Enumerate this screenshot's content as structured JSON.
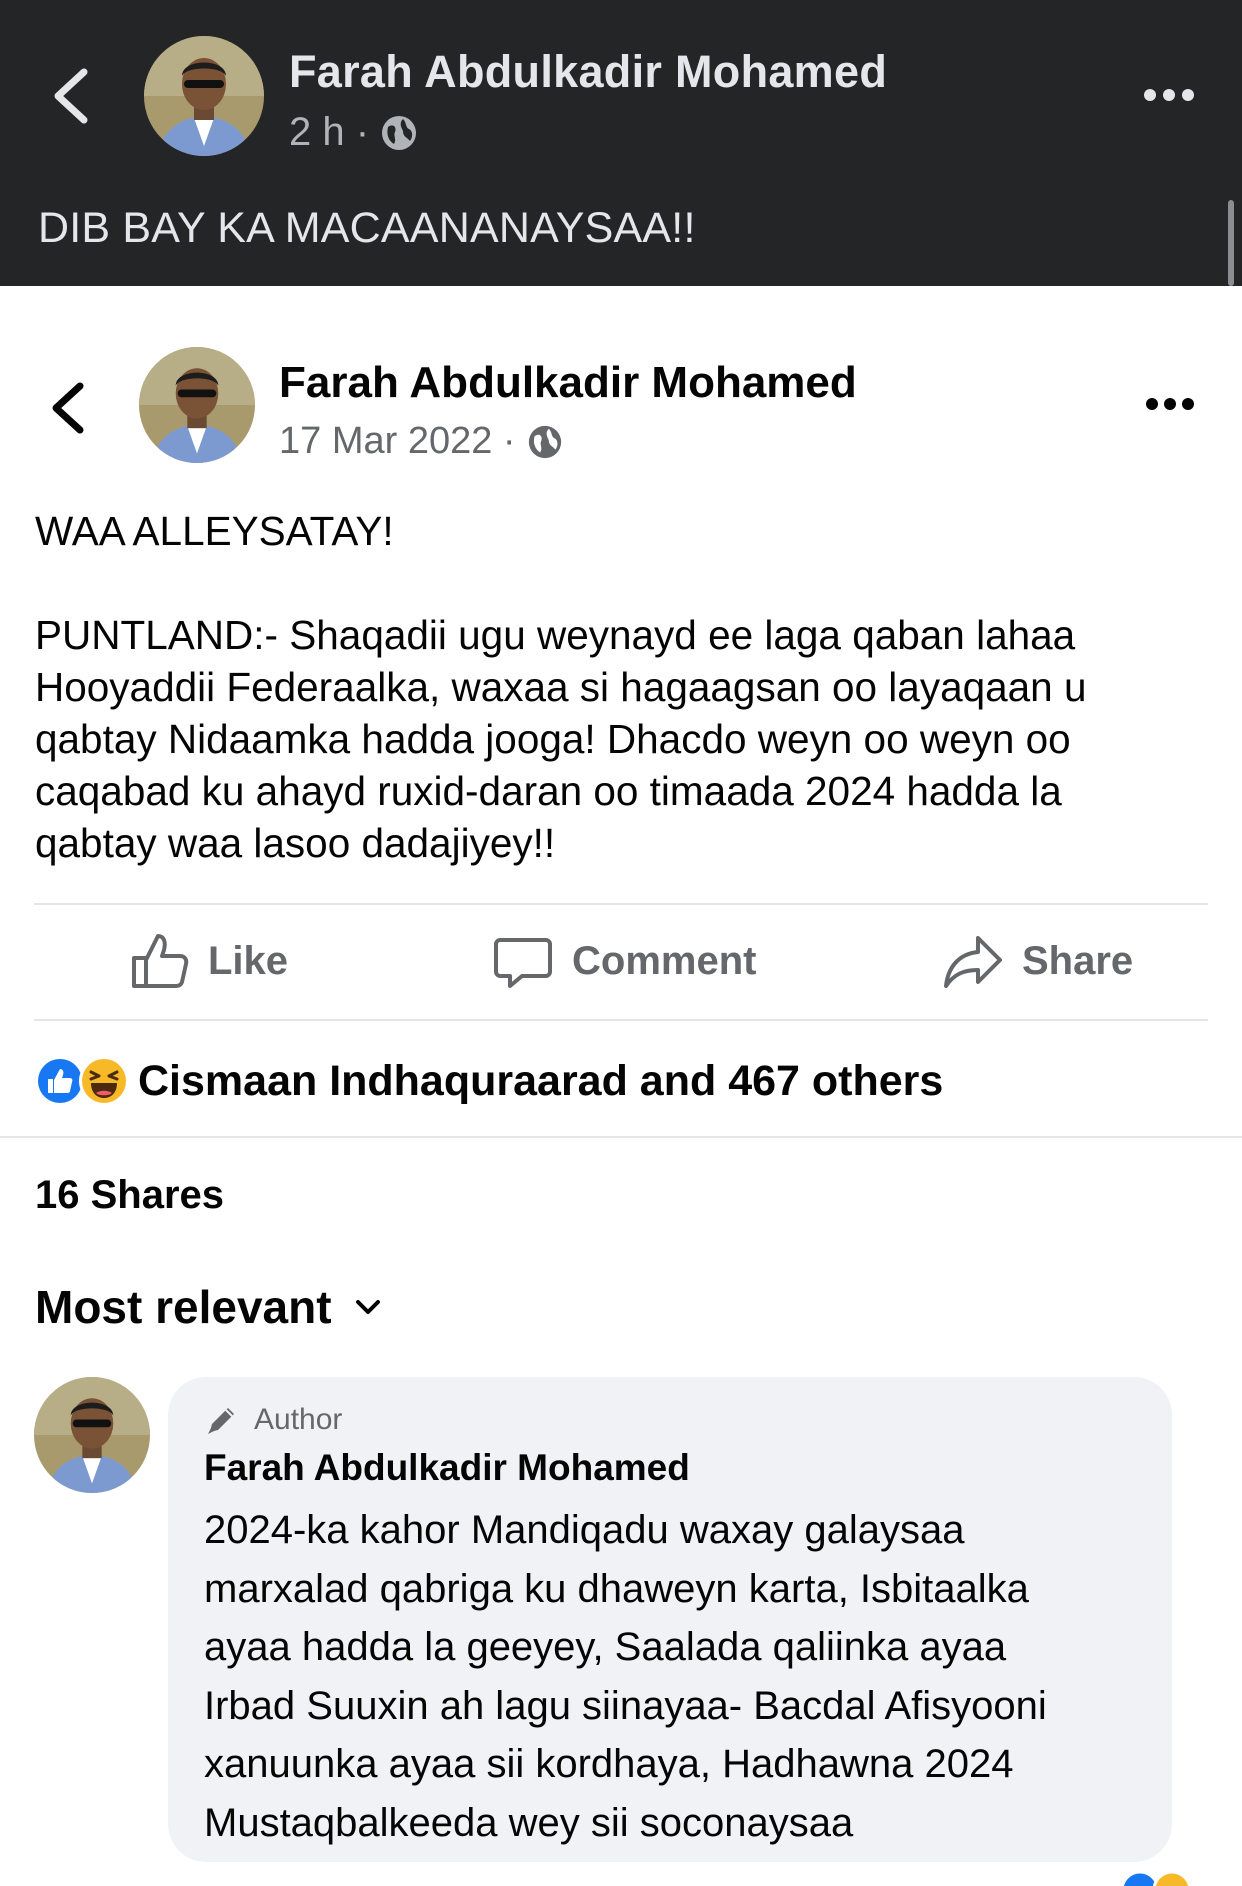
{
  "top_post": {
    "author": "Farah Abdulkadir Mohamed",
    "time": "2 h ·",
    "caption": "DIB BAY KA MACAANANAYSAA!!"
  },
  "shared_post": {
    "author": "Farah Abdulkadir Mohamed",
    "date": "17 Mar 2022 ·",
    "heading": "WAA ALLEYSATAY!",
    "lines": [
      "PUNTLAND:- Shaqadii ugu weynayd ee laga qaban lahaa",
      "Hooyaddii Federaalka, waxaa si hagaagsan oo layaqaan u",
      "qabtay Nidaamka hadda jooga! Dhacdo weyn oo weyn oo",
      "caqabad ku ahayd ruxid-daran oo timaada 2024 hadda la",
      "qabtay waa lasoo dadajiyey!!"
    ],
    "actions": {
      "like": "Like",
      "comment": "Comment",
      "share": "Share"
    },
    "reactions_text": "Cismaan Indhaquraarad and 467 others",
    "shares_text": "16 Shares",
    "sort_label": "Most relevant"
  },
  "comment": {
    "badge": "Author",
    "author": "Farah Abdulkadir Mohamed",
    "lines": [
      "2024-ka kahor Mandiqadu waxay galaysaa",
      "marxalad qabriga ku dhaweyn karta, Isbitaalka",
      "ayaa hadda la geeyey, Saalada qaliinka ayaa",
      "Irbad Suuxin ah lagu siinayaa- Bacdal Afisyooni",
      "xanuunka ayaa sii kordhaya, Hadhawna 2024",
      "Mustaqbalkeeda wey sii soconaysaa"
    ]
  },
  "icons": {
    "back": "chevron-left-icon",
    "more": "more-horizontal-icon",
    "audience": "globe-icon",
    "like": "thumbs-up-icon",
    "comment": "speech-bubble-icon",
    "share": "share-arrow-icon",
    "author_badge": "pencil-icon",
    "sort": "chevron-down-icon"
  },
  "colors": {
    "dark_header": "#242526",
    "like_blue": "#1877f2",
    "haha_yellow": "#f7b928",
    "secondary_text": "#65676b",
    "bubble_bg": "#f0f2f5"
  }
}
